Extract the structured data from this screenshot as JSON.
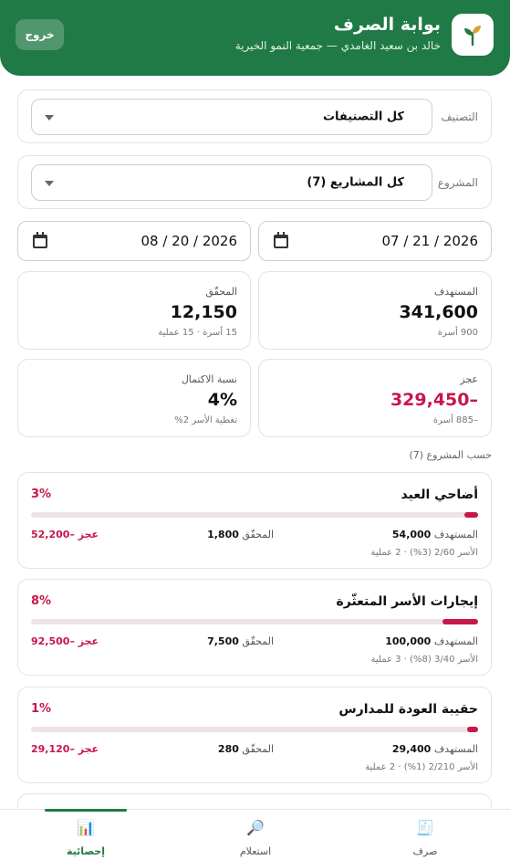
{
  "header": {
    "title": "بوابة الصرف",
    "subtitle": "خالد بن سعيد الغامدي — جمعية النمو الخيرية",
    "logout_label": "خروج"
  },
  "filters": {
    "category": {
      "label": "التصنيف",
      "value": "كل التصنيفات"
    },
    "project": {
      "label": "المشروع",
      "value": "كل المشاريع (7)"
    },
    "date_from": "07 / 21 / 2026",
    "date_to": "08 / 20 / 2026"
  },
  "stats": {
    "target": {
      "label": "المستهدف",
      "value": "341,600",
      "note": "900 أسرة"
    },
    "achieved": {
      "label": "المحقّق",
      "value": "12,150",
      "note": "15 أسرة · 15 عملية"
    },
    "deficit": {
      "label": "عجز",
      "value": "–329,450",
      "note": "–885 أسرة"
    },
    "completion": {
      "label": "نسبة الاكتمال",
      "value": "4%",
      "note": "تغطية الأسر 2%"
    }
  },
  "section_title": "حسب المشروع (7)",
  "projects": [
    {
      "name": "أضاحي العيد",
      "pct_label": "3%",
      "progress": 0.03,
      "target_label": "المستهدف",
      "target_value": "54,000",
      "achieved_label": "المحقّق",
      "achieved_value": "1,800",
      "deficit": "عجز –52,200",
      "note": "الأسر 2/60 (3%) · 2 عملية"
    },
    {
      "name": "إيجارات الأسر المتعثّرة",
      "pct_label": "8%",
      "progress": 0.08,
      "target_label": "المستهدف",
      "target_value": "100,000",
      "achieved_label": "المحقّق",
      "achieved_value": "7,500",
      "deficit": "عجز –92,500",
      "note": "الأسر 3/40 (8%) · 3 عملية"
    },
    {
      "name": "حقيبة العودة للمدارس",
      "pct_label": "1%",
      "progress": 0.01,
      "target_label": "المستهدف",
      "target_value": "29,400",
      "achieved_label": "المحقّق",
      "achieved_value": "280",
      "deficit": "عجز –29,120",
      "note": "الأسر 2/210 (1%) · 2 عملية"
    }
  ],
  "nav": [
    {
      "label": "صرف",
      "icon": "receipt-icon",
      "glyph": "🧾"
    },
    {
      "label": "استعلام",
      "icon": "magnifier-icon",
      "glyph": "🔎"
    },
    {
      "label": "إحصائية",
      "icon": "bar-chart-icon",
      "glyph": "📊"
    }
  ],
  "colors": {
    "brand": "#1f7a45",
    "negative": "#c8174a"
  }
}
